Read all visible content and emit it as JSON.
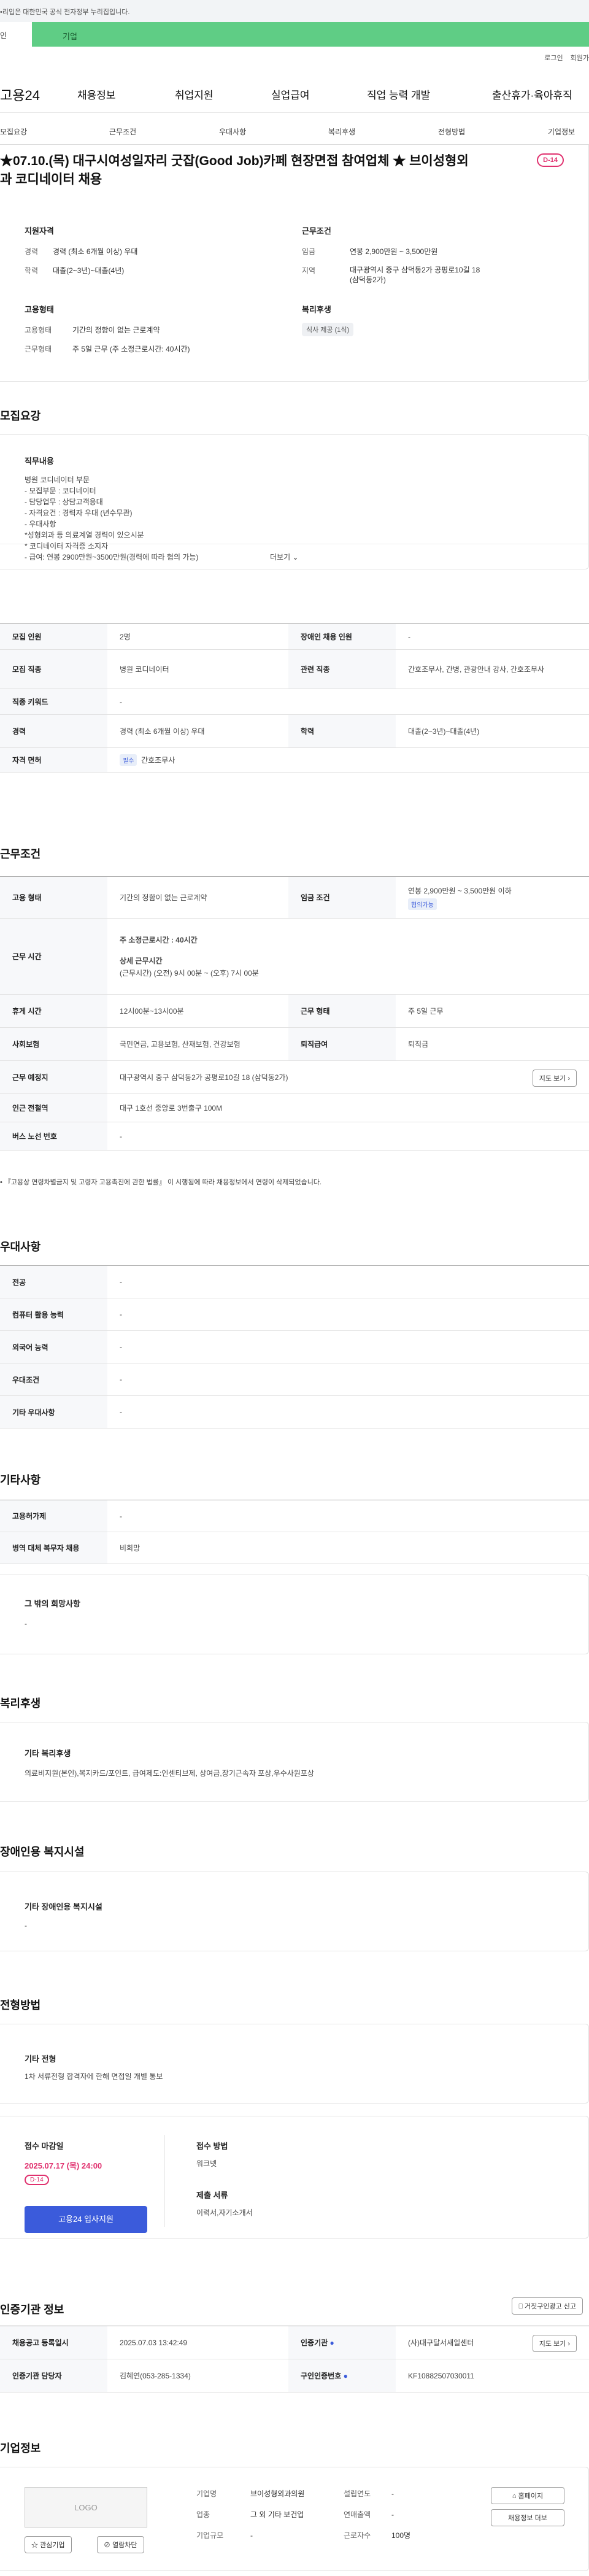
{
  "gov_notice": "•리입은 대한민국 공식 전자정부 누리집입니다.",
  "tabs": {
    "person": "인",
    "company": "기업"
  },
  "util": {
    "login": "로그인",
    "join": "회원가"
  },
  "gnb": {
    "logo": "고용24",
    "items": [
      "채용정보",
      "취업지원",
      "실업급여",
      "직업 능력 개발",
      "출산휴가·육아휴직"
    ]
  },
  "subnav": [
    "모집요강",
    "근무조건",
    "우대사항",
    "복리후생",
    "전형방법",
    "기업정보"
  ],
  "hero": {
    "title": "★07.10.(목) 대구시여성일자리 굿잡(Good Job)카페 현장면접 참여업체 ★ 브이성형외과 코디네이터 채용",
    "dday": "D-14",
    "qual_title": "지원자격",
    "cond_title": "근무조건",
    "exp_label": "경력",
    "exp_value": "경력 (최소 6개월 이상) 우대",
    "edu_label": "학력",
    "edu_value": "대졸(2~3년)~대졸(4년)",
    "pay_label": "임금",
    "pay_value": "연봉 2,900만원 ~ 3,500만원",
    "loc_label": "지역",
    "loc_value": "대구광역시 중구 삼덕동2가 공평로10길 18 (삼덕동2가)",
    "emp_title": "고용형태",
    "welfare_title": "복리후생",
    "type_label": "고용형태",
    "type_value": "기간의 정함이 없는 근로계약",
    "hours_label": "근무형태",
    "hours_value": "주 5일 근무 (주 소정근로시간: 40시간)",
    "meal_tag": "식사 제공 (1식)"
  },
  "sections": {
    "recruit": "모집요강",
    "conditions": "근무조건",
    "preference": "우대사항",
    "etc": "기타사항",
    "welfare": "복리후생",
    "disabled": "장애인용 복지시설",
    "selection": "전형방법",
    "cert": "인증기관 정보",
    "company": "기업정보"
  },
  "duty": {
    "title": "직무내용",
    "lines": [
      "병원 코디네이터 부문",
      "- 모집부문 : 코디네이터",
      "- 담당업무 : 상담고객응대",
      "- 자격요건 :  경력자 우대 (년수무관)",
      "- 우대사항",
      "  *성형외과 등 의료계열 경력이 있으시분",
      "  * 코디네이터 자격증 소지자",
      "- 급여: 연봉 2900만원~3500만원(경력에 따라 협의 가능)"
    ],
    "more": "더보기"
  },
  "recruit_table": [
    {
      "k1": "모집 인원",
      "v1": "2명",
      "k2": "장애인 채용 인원",
      "v2": "-"
    },
    {
      "k1": "모집 직종",
      "v1": "병원 코디네이터",
      "k2": "관련 직종",
      "v2": "간호조무사, 간병, 관광안내 강사, 간호조무사"
    },
    {
      "k1": "직종 키워드",
      "v1": "-"
    },
    {
      "k1": "경력",
      "v1": "경력 (최소 6개월 이상) 우대",
      "k2": "학력",
      "v2": "대졸(2~3년)~대졸(4년)"
    },
    {
      "k1": "자격 면허",
      "v1": "간호조무사",
      "tag": "필수"
    }
  ],
  "cond_table": {
    "r1": {
      "k1": "고용 형태",
      "v1": "기간의 정함이 없는 근로계약",
      "k2": "임금 조건",
      "v2": "연봉 2,900만원 ~ 3,500만원 이하",
      "v2tag": "협의가능"
    },
    "r2": {
      "k": "근무 시간",
      "weekly": "주 소정근로시간 : 40시간",
      "detail_title": "상세 근무시간",
      "detail": "(근무시간) (오전) 9시 00분 ~ (오후) 7시 00분"
    },
    "r3": {
      "k1": "휴게 시간",
      "v1": "12시00분~13시00분",
      "k2": "근무 형태",
      "v2": "주 5일 근무"
    },
    "r4": {
      "k1": "사회보험",
      "v1": "국민연금, 고용보험, 산재보험, 건강보험",
      "k2": "퇴직급여",
      "v2": "퇴직금"
    },
    "r5": {
      "k": "근무 예정지",
      "v": "대구광역시 중구 삼덕동2가 공평로10길 18 (삼덕동2가)",
      "btn": "지도 보기"
    },
    "r6": {
      "k": "인근 전철역",
      "v": "대구 1호선 중앙로 3번출구 100M"
    },
    "r7": {
      "k": "버스 노선 번호",
      "v": "-"
    },
    "note": "• 『고용상 연령차별금지 및 고령자 고용촉진에 관한 법률』 이 시행됨에 따라 채용정보에서 연령이 삭제되었습니다."
  },
  "pref_table": [
    {
      "k": "전공",
      "v": "-"
    },
    {
      "k": "컴퓨터 활용 능력",
      "v": "-"
    },
    {
      "k": "외국어 능력",
      "v": "-"
    },
    {
      "k": "우대조건",
      "v": "-"
    },
    {
      "k": "기타 우대사항",
      "v": "-"
    }
  ],
  "etc_table": [
    {
      "k": "고용허가제",
      "v": "-"
    },
    {
      "k": "병역 대체 복무자 채용",
      "v": "비희망"
    }
  ],
  "etc_box": {
    "title": "그 밖의 희망사항",
    "value": "-"
  },
  "welfare_box": {
    "title": "기타 복리후생",
    "value": "의료비지원(본인),복지카드/포인트, 급여제도:인센티브제, 상여금,장기근속자 포상,우수사원포상"
  },
  "disabled_box": {
    "title": "기타 장애인용 복지시설",
    "value": "-"
  },
  "sel_box": {
    "title": "기타 전형",
    "value": "1차 서류전형 합격자에 한해 면접일 개별 통보"
  },
  "deadline": {
    "title": "접수 마감일",
    "date": "2025.07.17 (목) 24:00",
    "dday": "D-14",
    "apply": "고용24 입사지원",
    "method_title": "접수 방법",
    "method": "워크넷",
    "docs_title": "제출 서류",
    "docs": "이력서,자기소개서"
  },
  "cert": {
    "btn": "거짓구인광고 신고",
    "r1": {
      "k1": "채용공고 등록일시",
      "v1": "2025.07.03 13:42:49",
      "k2": "인증기관",
      "v2": "(사)대구달서새일센터",
      "btn": "지도 보기"
    },
    "r2": {
      "k1": "인증기관 담당자",
      "v1": "김혜연(053-285-1334)",
      "k2": "구인인증번호",
      "v2": "KF10882507030011"
    }
  },
  "company": {
    "logo": "LOGO",
    "fav": "관심기업",
    "block": "열람차단",
    "name_k": "기업명",
    "name_v": "브이성형외과의원",
    "est_k": "설립연도",
    "est_v": "-",
    "ind_k": "업종",
    "ind_v": "그 외 기타 보건업",
    "sales_k": "연매출액",
    "sales_v": "-",
    "size_k": "기업규모",
    "size_v": "-",
    "emp_k": "근로자수",
    "emp_v": "100명",
    "home": "홈페이지",
    "more": "채용정보 더보"
  }
}
